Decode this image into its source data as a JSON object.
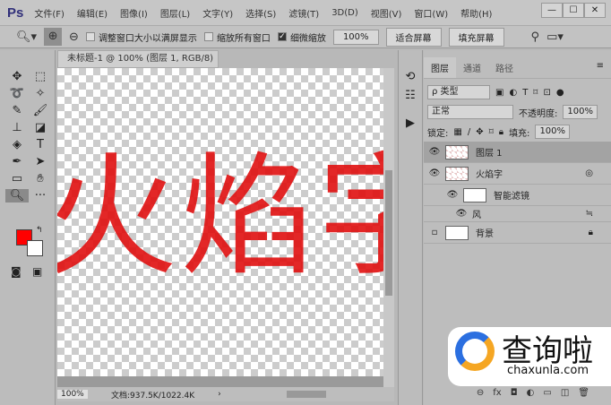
{
  "app": {
    "logo": "Ps",
    "menus": [
      "文件(F)",
      "编辑(E)",
      "图像(I)",
      "图层(L)",
      "文字(Y)",
      "选择(S)",
      "滤镜(T)",
      "3D(D)",
      "视图(V)",
      "窗口(W)",
      "帮助(H)"
    ],
    "window_buttons": [
      "—",
      "☐",
      "✕"
    ]
  },
  "options": {
    "resize_windows": "调整窗口大小以满屏显示",
    "zoom_all": "缩放所有窗口",
    "scrubby_zoom": "细微缩放",
    "zoom_value": "100%",
    "fit_screen": "适合屏幕",
    "fill_screen": "填充屏幕",
    "resize_checked": false,
    "zoom_all_checked": false,
    "scrubby_checked": true
  },
  "document": {
    "tab_title": "未标题-1 @ 100% (图层 1, RGB/8) *",
    "close": "×",
    "canvas_text": "火焰字",
    "text_color": "#e01010"
  },
  "status": {
    "zoom": "100%",
    "doc_size": "文档:937.5K/1022.4K",
    "arrow": "›"
  },
  "layers_panel": {
    "tabs": [
      "图层",
      "通道",
      "路径"
    ],
    "filter_kind": "ρ 类型",
    "blend_mode": "正常",
    "opacity_label": "不透明度:",
    "opacity": "100%",
    "lock_label": "锁定:",
    "fill_label": "填充:",
    "fill": "100%",
    "layers": [
      {
        "name": "图层 1",
        "selected": true
      },
      {
        "name": "火焰字"
      },
      {
        "name": "智能滤镜"
      },
      {
        "name": "风"
      },
      {
        "name": "背景"
      }
    ]
  },
  "watermark": {
    "brand": "查询啦",
    "url": "chaxunla.com"
  }
}
